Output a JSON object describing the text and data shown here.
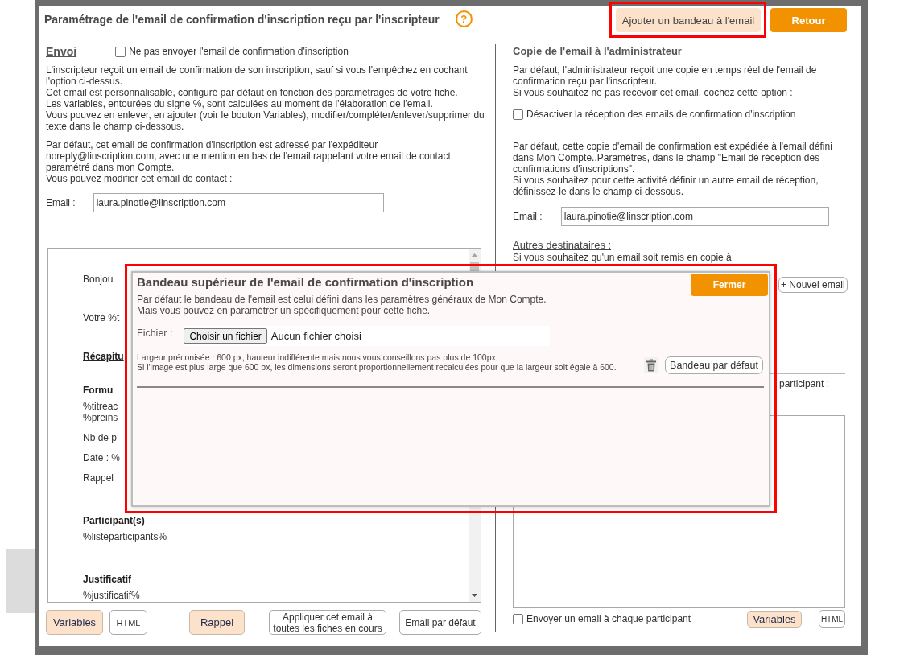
{
  "header": {
    "title": "Paramétrage de l'email de confirmation d'inscription reçu par l'inscripteur",
    "help_label": "?"
  },
  "top_buttons": [
    {
      "label": "Ajouter un bandeau à l'email",
      "kind": "secondary",
      "highlighted": true
    },
    {
      "label": "Retour",
      "kind": "primary",
      "highlighted": false
    }
  ],
  "sending": {
    "heading": "Envoi",
    "disable_checkbox": {
      "label": "Ne pas envoyer l'email de confirmation d'inscription",
      "checked": false
    },
    "paragraphs": [
      [
        "L'inscripteur reçoit un email de confirmation de son inscription, sauf si vous l'empêchez en cochant",
        "l'option ci-dessus.",
        "Cet email est personnalisable, configuré par défaut en fonction des paramétrages de votre fiche.",
        "Les variables, entourées du signe %, sont calculées au moment de l'élaboration de l'email.",
        "Vous pouvez en enlever, en ajouter (voir le bouton Variables), modifier/compléter/enlever/supprimer du",
        "texte dans le champ ci-dessous."
      ],
      [
        "Par défaut, cet email de confirmation d'inscription est adressé par l'expéditeur",
        "noreply@linscription.com, avec une mention en bas de l'email rappelant votre email de contact",
        "paramétré dans mon Compte.",
        "Vous pouvez modifier cet email de contact :"
      ]
    ],
    "email_field": {
      "label": "Email :",
      "value": "laura.pinotie@linscription.com"
    },
    "editor_blocks": [
      {
        "kind": "paragraph",
        "lines": [
          "Bonjou"
        ]
      },
      {
        "kind": "paragraph",
        "lines": [
          "Votre %t"
        ]
      },
      {
        "kind": "section_title",
        "lines": [
          "Récapitu"
        ]
      },
      {
        "kind": "subheading",
        "lines": [
          "Formu"
        ]
      },
      {
        "kind": "line",
        "lines": [
          "%titreac",
          "%preins"
        ]
      },
      {
        "kind": "line",
        "lines": [
          "Nb de p"
        ]
      },
      {
        "kind": "line",
        "lines": [
          "Date : %"
        ]
      },
      {
        "kind": "line",
        "lines": [
          "Rappel"
        ]
      },
      {
        "kind": "subheading",
        "lines": [
          "Participant(s)"
        ]
      },
      {
        "kind": "line",
        "lines": [
          "%listeparticipants%"
        ]
      },
      {
        "kind": "subheading",
        "lines": [
          "Justificatif"
        ]
      },
      {
        "kind": "line",
        "lines": [
          "%justificatif%"
        ]
      }
    ],
    "buttons": [
      {
        "label": "Variables",
        "kind": "accent"
      },
      {
        "label": "HTML",
        "kind": "small"
      },
      {
        "label": "Rappel",
        "kind": "accent"
      },
      {
        "label": "Appliquer cet email à toutes les fiches en cours",
        "kind": "plain"
      },
      {
        "label": "Email par défaut",
        "kind": "plain"
      }
    ]
  },
  "admin_copy": {
    "heading": "Copie de l'email à l'administrateur",
    "intro": [
      "Par défaut, l'administrateur reçoit une copie en temps réel de l'email de",
      "confirmation reçu par l'inscripteur.",
      "Si vous souhaitez ne pas recevoir cet email, cochez cette option :"
    ],
    "disable_checkbox": {
      "label": "Désactiver la réception des emails de confirmation d'inscription",
      "checked": false
    },
    "details": [
      "Par défaut, cette copie d'email de confirmation est expédiée à l'email défini",
      "dans Mon Compte..Paramètres, dans le champ \"Email de réception des",
      "confirmations d'inscriptions\".",
      "Si vous souhaitez pour cette activité définir un autre email de réception,",
      "définissez-le dans le champ ci-dessous."
    ],
    "email_field": {
      "label": "Email :",
      "value": "laura.pinotie@linscription.com"
    },
    "other_recipients": {
      "heading": "Autres destinataires :",
      "text": "Si vous souhaitez qu'un email soit remis en copie à",
      "add_button": "+ Nouvel email"
    },
    "participant_label": "participant :",
    "each_participant_checkbox": {
      "label": "Envoyer un email à chaque participant",
      "checked": false
    },
    "buttons": [
      {
        "label": "Variables",
        "kind": "accent"
      },
      {
        "label": "HTML",
        "kind": "small"
      }
    ]
  },
  "banner_dialog": {
    "title": "Bandeau supérieur de l'email de confirmation d'inscription",
    "highlighted": true,
    "close_button": "Fermer",
    "description": [
      "Par défaut le bandeau de l'email est celui défini dans les paramètres généraux de Mon Compte.",
      "Mais vous pouvez en paramétrer un spécifiquement pour cette fiche."
    ],
    "file_label": "Fichier :",
    "file_button": "Choisir un fichier",
    "file_status": "Aucun fichier choisi",
    "notes": [
      "Largeur préconisée : 600 px, hauteur indifférente mais nous vous conseillons pas plus de 100px",
      "Si l'image est plus large que 600 px, les dimensions seront proportionnellement recalculées pour que la largeur soit égale à 600."
    ],
    "default_button": "Bandeau par défaut"
  }
}
